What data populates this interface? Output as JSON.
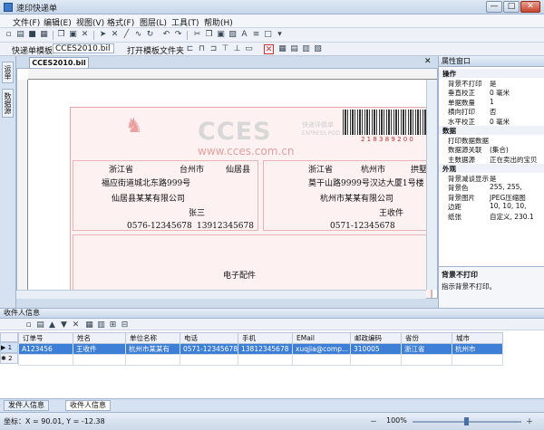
{
  "window": {
    "title": "速印快递单",
    "min": "—",
    "max": "□",
    "close": "✕"
  },
  "menu": [
    "文件(F)",
    "编辑(E)",
    "视图(V)",
    "格式(F)",
    "图层(L)",
    "工具(T)",
    "帮助(H)"
  ],
  "toolbar2": {
    "template_label": "快递单模板",
    "template_value": "CCES2010.bil",
    "open_folder": "打开模板文件夹"
  },
  "left_tabs": [
    "运单",
    "数据源"
  ],
  "document": {
    "tab": "CCES2010.bil"
  },
  "waybill": {
    "logo_text": "CCES",
    "logo_sub": "快递详情单",
    "logo_sub2": "EXPRESS POD",
    "url": "www.cces.com.cn",
    "barcode_number": "2 1 8 3 8 9 2 0 0",
    "sender": {
      "province": "浙江省",
      "city": "台州市",
      "county": "仙居县",
      "address": "福应街道城北东路999号",
      "company": "仙居县某某有限公司",
      "name": "张三",
      "phone": "0576-12345678",
      "mobile": "13912345678"
    },
    "receiver": {
      "province": "浙江省",
      "city": "杭州市",
      "county": "拱墅",
      "address": "莫干山路9999号汉达大厦1号楼",
      "company": "杭州市某某有限公司",
      "name": "王收件",
      "phone": "0571-12345678"
    },
    "goods": "电子配件"
  },
  "props": {
    "title": "属性窗口",
    "rows": [
      {
        "k": "操作",
        "v": "",
        "cat": true
      },
      {
        "k": "背景不打印",
        "v": "是",
        "cat": false
      },
      {
        "k": "垂直校正",
        "v": "0 毫米",
        "cat": false
      },
      {
        "k": "单据数量",
        "v": "1",
        "cat": false
      },
      {
        "k": "横向打印",
        "v": "否",
        "cat": false
      },
      {
        "k": "水平校正",
        "v": "0 毫米",
        "cat": false
      },
      {
        "k": "数据",
        "v": "",
        "cat": true
      },
      {
        "k": "打印数据数据",
        "v": "",
        "cat": false
      },
      {
        "k": "数据源关联",
        "v": "(集合)",
        "cat": false
      },
      {
        "k": "主数据源",
        "v": "正在卖出的宝贝",
        "cat": false
      },
      {
        "k": "外观",
        "v": "",
        "cat": true
      },
      {
        "k": "背景减谈显示",
        "v": "是",
        "cat": false
      },
      {
        "k": "背景色",
        "v": "255, 255,",
        "cat": false
      },
      {
        "k": "背景图片",
        "v": "JPEG压缩图",
        "cat": false
      },
      {
        "k": "边距",
        "v": "10, 10, 10,",
        "cat": false
      },
      {
        "k": "纸张",
        "v": "自定义, 230.1",
        "cat": false
      }
    ],
    "desc_title": "背景不打印",
    "desc_text": "指示背景不打印。"
  },
  "receiver_panel": {
    "title": "收件人信息",
    "columns": [
      "订单号",
      "姓名",
      "单位名称",
      "电话",
      "手机",
      "EMail",
      "邮政编码",
      "省份",
      "城市"
    ],
    "rows": [
      {
        "num": "1",
        "cells": [
          "A123456",
          "王收件",
          "杭州市某某有",
          "0571-12345678",
          "13812345678",
          "xuqjia@comp...",
          "310005",
          "浙江省",
          "杭州市"
        ]
      },
      {
        "num": "2",
        "cells": [
          "",
          "",
          "",
          "",
          "",
          "",
          "",
          "",
          ""
        ]
      }
    ]
  },
  "bottom_tabs": [
    "发件人信息",
    "收件人信息"
  ],
  "status": {
    "coords": "坐标：X = 90.01, Y = -12.38",
    "zoom": "100%"
  }
}
